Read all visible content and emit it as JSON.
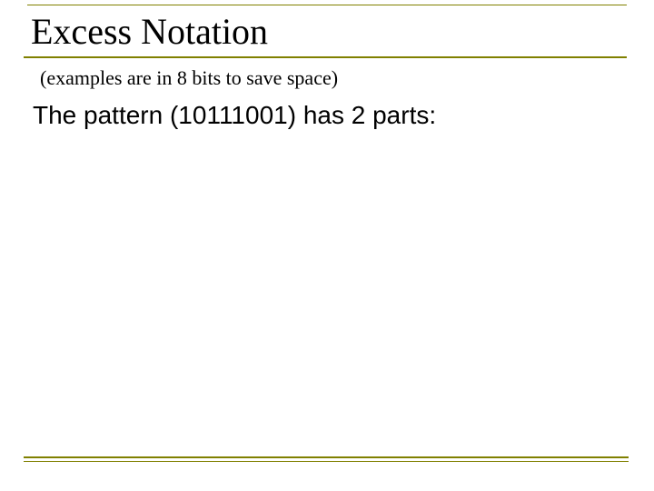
{
  "slide": {
    "title": "Excess Notation",
    "subtitle": "(examples are in 8 bits to save space)",
    "body": "The pattern (10111001) has 2 parts:"
  }
}
